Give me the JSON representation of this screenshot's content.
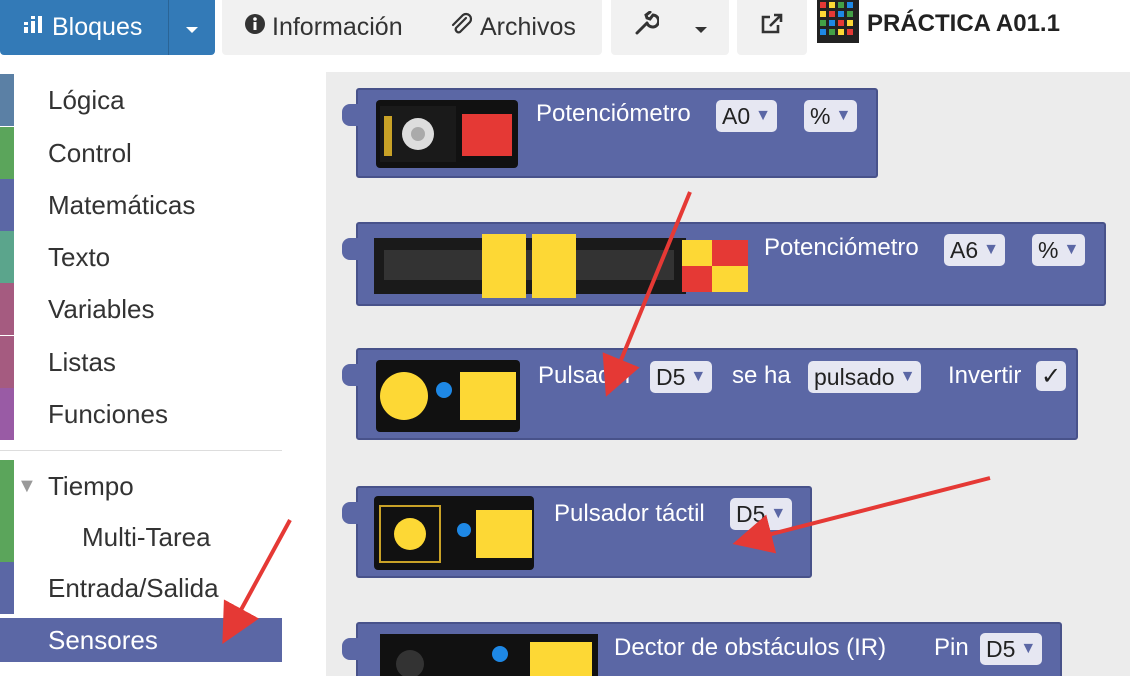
{
  "toolbar": {
    "blocks_label": "Bloques",
    "info_label": "Información",
    "files_label": "Archivos",
    "project_title": "PRÁCTICA A01.1"
  },
  "sidebar": {
    "categories": [
      {
        "label": "Lógica",
        "color": "#5b80a5"
      },
      {
        "label": "Control",
        "color": "#5ba55b"
      },
      {
        "label": "Matemáticas",
        "color": "#5b67a5"
      },
      {
        "label": "Texto",
        "color": "#5ba58c"
      },
      {
        "label": "Variables",
        "color": "#a55b80"
      },
      {
        "label": "Listas",
        "color": "#a55b80"
      },
      {
        "label": "Funciones",
        "color": "#995ba5"
      },
      {
        "label": "Tiempo",
        "color": "#5ba55b"
      },
      {
        "label": "Multi-Tarea",
        "color": "#5ba55b"
      },
      {
        "label": "Entrada/Salida",
        "color": "#5b67a5"
      },
      {
        "label": "Sensores",
        "color": "#5b67a5"
      }
    ]
  },
  "blocks": [
    {
      "label": "Potenciómetro",
      "pin": "A0",
      "unit": "%"
    },
    {
      "label": "Potenciómetro",
      "pin": "A6",
      "unit": "%"
    },
    {
      "label": "Pulsador",
      "pin": "D5",
      "mid": "se ha",
      "state": "pulsado",
      "invert_label": "Invertir",
      "checked": "✓"
    },
    {
      "label": "Pulsador táctil",
      "pin": "D5"
    },
    {
      "label": "Dector de obstáculos (IR)",
      "pin_label": "Pin",
      "pin": "D5"
    }
  ],
  "colors": {
    "block": "#5b67a5",
    "annotation_arrow": "#e53935",
    "toolbar_primary": "#337ab7"
  }
}
